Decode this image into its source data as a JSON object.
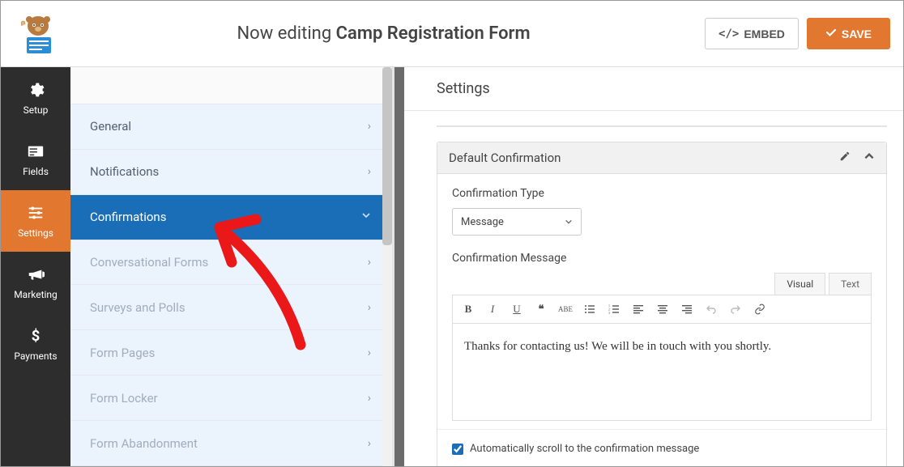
{
  "header": {
    "prefix": "Now editing ",
    "title": "Camp Registration Form",
    "embed_label": "EMBED",
    "save_label": "SAVE"
  },
  "leftnav": {
    "items": [
      {
        "label": "Setup",
        "key": "setup"
      },
      {
        "label": "Fields",
        "key": "fields"
      },
      {
        "label": "Settings",
        "key": "settings"
      },
      {
        "label": "Marketing",
        "key": "marketing"
      },
      {
        "label": "Payments",
        "key": "payments"
      }
    ],
    "active": "settings"
  },
  "sidebar": {
    "items": [
      {
        "label": "General",
        "key": "general",
        "state": "normal"
      },
      {
        "label": "Notifications",
        "key": "notifications",
        "state": "normal"
      },
      {
        "label": "Confirmations",
        "key": "confirmations",
        "state": "active"
      },
      {
        "label": "Conversational Forms",
        "key": "conversational",
        "state": "muted"
      },
      {
        "label": "Surveys and Polls",
        "key": "surveys",
        "state": "muted"
      },
      {
        "label": "Form Pages",
        "key": "formpages",
        "state": "muted"
      },
      {
        "label": "Form Locker",
        "key": "formlocker",
        "state": "muted"
      },
      {
        "label": "Form Abandonment",
        "key": "abandonment",
        "state": "muted"
      }
    ]
  },
  "main": {
    "title": "Settings",
    "panel": {
      "title": "Default Confirmation",
      "type_label": "Confirmation Type",
      "type_value": "Message",
      "message_label": "Confirmation Message",
      "editor_tabs": {
        "visual": "Visual",
        "text": "Text"
      },
      "message_value": "Thanks for contacting us! We will be in touch with you shortly.",
      "auto_scroll_label": "Automatically scroll to the confirmation message",
      "auto_scroll_checked": true
    }
  },
  "colors": {
    "accent": "#e27730",
    "primary": "#1a6db7",
    "annotation": "#ea1818"
  }
}
